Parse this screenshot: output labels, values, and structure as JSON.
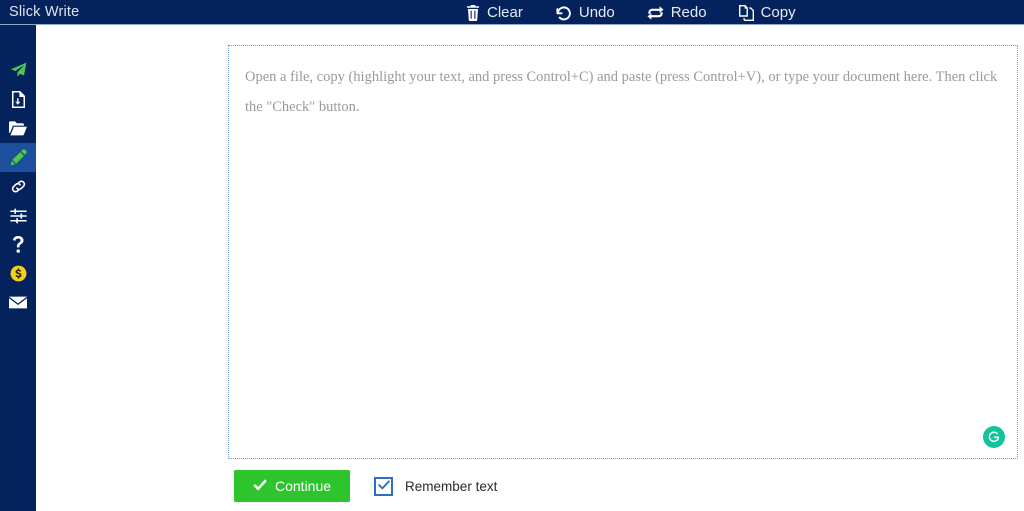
{
  "header": {
    "brand": "Slick Write",
    "background_color": "#04225c",
    "actions": [
      {
        "label": "Clear",
        "icon": "trash-icon"
      },
      {
        "label": "Undo",
        "icon": "undo-arrow-icon"
      },
      {
        "label": "Redo",
        "icon": "redo-repeat-icon"
      },
      {
        "label": "Copy",
        "icon": "copy-documents-icon"
      }
    ]
  },
  "sidebar": {
    "background_color": "#04225c",
    "active_color": "#1c4f9c",
    "items": [
      {
        "icon": "paper-plane-icon",
        "color": "#4cc94c",
        "active": false
      },
      {
        "icon": "file-download-icon",
        "color": "#ffffff",
        "active": false
      },
      {
        "icon": "folder-open-icon",
        "color": "#ffffff",
        "active": false
      },
      {
        "icon": "pencil-icon",
        "color": "#4cc94c",
        "active": true
      },
      {
        "icon": "link-chain-icon",
        "color": "#ffffff",
        "active": false
      },
      {
        "icon": "sliders-icon",
        "color": "#ffffff",
        "active": false
      },
      {
        "icon": "question-mark-icon",
        "color": "#ffffff",
        "active": false
      },
      {
        "icon": "dollar-coin-icon",
        "color": "#f5d018",
        "active": false
      },
      {
        "icon": "envelope-icon",
        "color": "#ffffff",
        "active": false
      }
    ]
  },
  "editor": {
    "placeholder": "Open a file, copy (highlight your text, and press Control+C) and paste (press Control+V), or type your document here. Then click the \"Check\" button.",
    "value": "",
    "border_color": "#6f9fd8",
    "grammarly": {
      "icon": "grammarly-g-icon",
      "color": "#15c39a"
    }
  },
  "footer": {
    "continue_label": "Continue",
    "continue_icon": "check-icon",
    "continue_color": "#2ec42e",
    "remember_label": "Remember text",
    "remember_checked": true,
    "checkbox_color": "#2c6fc4"
  }
}
